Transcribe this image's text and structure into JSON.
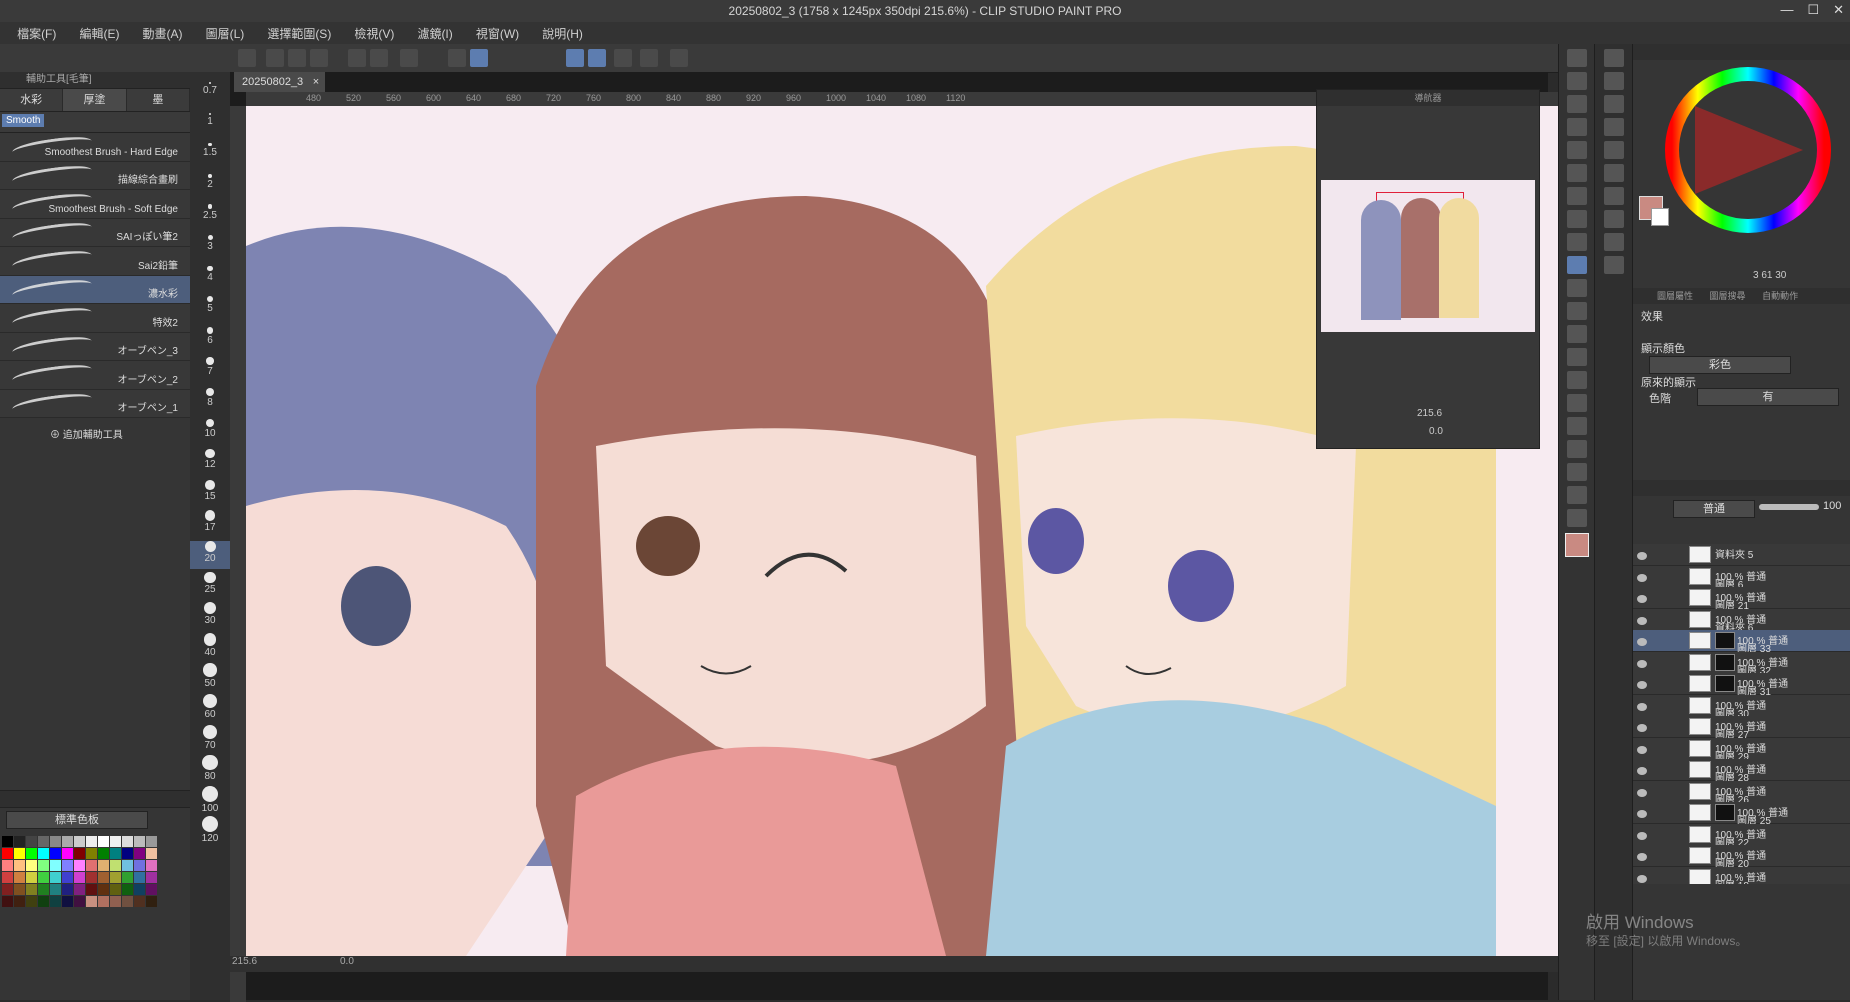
{
  "window": {
    "title": "20250802_3 (1758 x 1245px 350dpi 215.6%) - CLIP STUDIO PAINT PRO"
  },
  "menu": [
    "檔案(F)",
    "編輯(E)",
    "動畫(A)",
    "圖層(L)",
    "選擇範圍(S)",
    "檢視(V)",
    "濾鏡(I)",
    "視窗(W)",
    "說明(H)"
  ],
  "left_panel": {
    "header": "輔助工具[毛筆]",
    "tabs": [
      "水彩",
      "厚塗",
      "墨"
    ],
    "group_chip": "Smooth",
    "brushes": [
      {
        "name": "Smoothest Brush - Hard Edge"
      },
      {
        "name": "描線綜合畫刷"
      },
      {
        "name": "Smoothest Brush - Soft Edge"
      },
      {
        "name": "SAIっぽい筆2"
      },
      {
        "name": "Sai2鉛筆"
      },
      {
        "name": "濃水彩"
      },
      {
        "name": "特效2"
      },
      {
        "name": "オーブペン_3"
      },
      {
        "name": "オーブペン_2"
      },
      {
        "name": "オーブペン_1"
      }
    ],
    "add_subtool": "追加輔助工具"
  },
  "brush_sizes": [
    "0.7",
    "1",
    "1.5",
    "2",
    "2.5",
    "3",
    "4",
    "5",
    "6",
    "7",
    "8",
    "10",
    "12",
    "15",
    "17",
    "20",
    "25",
    "30",
    "40",
    "50",
    "60",
    "70",
    "80",
    "100",
    "120"
  ],
  "palette": {
    "name": "標準色板"
  },
  "canvas": {
    "doc_tab": "20250802_3",
    "ruler_marks": [
      "480",
      "520",
      "560",
      "600",
      "640",
      "680",
      "720",
      "760",
      "800",
      "840",
      "880",
      "920",
      "960",
      "1000",
      "1040",
      "1080",
      "1120"
    ],
    "zoom": "215.6",
    "rotation": "0.0"
  },
  "navigator": {
    "title": "導航器",
    "zoom": "215.6",
    "angle": "0.0"
  },
  "property_panel": {
    "tabs": [
      "圖層屬性",
      "圖層搜尋",
      "自動動作"
    ],
    "effect_label": "效果",
    "display_color_label": "顯示顏色",
    "display_color_value": "彩色",
    "original_display_label": "原來的顯示",
    "tone_label": "色階",
    "tone_value": "有"
  },
  "color_wheel": {
    "numbers": "3  61  30"
  },
  "layers": {
    "blend_mode": "普通",
    "opacity": "100",
    "items": [
      {
        "l1": "資料夾 5",
        "l2": "",
        "mask": false,
        "sel": false
      },
      {
        "l1": "100 % 普通",
        "l2": "圖層 6",
        "mask": false,
        "sel": false
      },
      {
        "l1": "100 % 普通",
        "l2": "圖層 21",
        "mask": false,
        "sel": false
      },
      {
        "l1": "100 % 普通",
        "l2": "資料夾 6",
        "mask": false,
        "sel": false,
        "folder": true
      },
      {
        "l1": "100 % 普通",
        "l2": "圖層 33",
        "mask": true,
        "sel": true
      },
      {
        "l1": "100 % 普通",
        "l2": "圖層 32",
        "mask": true,
        "sel": false
      },
      {
        "l1": "100 % 普通",
        "l2": "圖層 31",
        "mask": true,
        "sel": false
      },
      {
        "l1": "100 % 普通",
        "l2": "圖層 30",
        "mask": false,
        "sel": false
      },
      {
        "l1": "100 % 普通",
        "l2": "圖層 27",
        "mask": false,
        "sel": false
      },
      {
        "l1": "100 % 普通",
        "l2": "圖層 29",
        "mask": false,
        "sel": false
      },
      {
        "l1": "100 % 普通",
        "l2": "圖層 28",
        "mask": false,
        "sel": false
      },
      {
        "l1": "100 % 普通",
        "l2": "圖層 26",
        "mask": false,
        "sel": false
      },
      {
        "l1": "100 % 普通",
        "l2": "圖層 25",
        "mask": true,
        "sel": false
      },
      {
        "l1": "100 % 普通",
        "l2": "圖層 22",
        "mask": false,
        "sel": false
      },
      {
        "l1": "100 % 普通",
        "l2": "圖層 20",
        "mask": false,
        "sel": false
      },
      {
        "l1": "100 % 普通",
        "l2": "圖層 18",
        "mask": false,
        "sel": false
      }
    ]
  },
  "watermark": {
    "line1": "啟用 Windows",
    "line2": "移至 [設定] 以啟用 Windows。"
  },
  "colors": {
    "accent": "#5d7db0",
    "main_color": "#c98a82",
    "sub_color": "#ffffff"
  }
}
